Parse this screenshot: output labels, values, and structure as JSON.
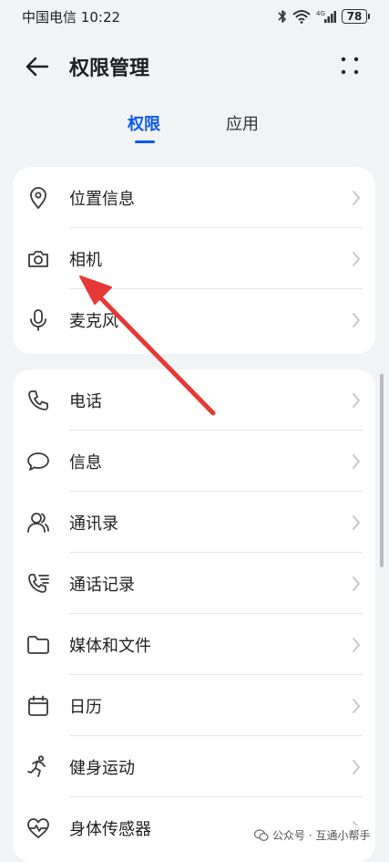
{
  "status_bar": {
    "carrier": "中国电信",
    "time": "10:22",
    "battery": "78"
  },
  "header": {
    "title": "权限管理"
  },
  "tabs": [
    {
      "label": "权限",
      "active": true
    },
    {
      "label": "应用",
      "active": false
    }
  ],
  "groups": [
    {
      "items": [
        {
          "label": "位置信息",
          "icon": "location-pin-icon"
        },
        {
          "label": "相机",
          "icon": "camera-icon"
        },
        {
          "label": "麦克风",
          "icon": "microphone-icon"
        }
      ]
    },
    {
      "items": [
        {
          "label": "电话",
          "icon": "phone-icon"
        },
        {
          "label": "信息",
          "icon": "message-bubble-icon"
        },
        {
          "label": "通讯录",
          "icon": "contacts-icon"
        },
        {
          "label": "通话记录",
          "icon": "call-log-icon"
        },
        {
          "label": "媒体和文件",
          "icon": "folder-icon"
        },
        {
          "label": "日历",
          "icon": "calendar-icon"
        },
        {
          "label": "健身运动",
          "icon": "running-icon"
        },
        {
          "label": "身体传感器",
          "icon": "heart-rate-icon"
        }
      ]
    }
  ],
  "watermark": {
    "text": "公众号 · 互通小帮手"
  },
  "colors": {
    "accent": "#0a59f7",
    "background": "#f1f3f5",
    "annotation_arrow": "#e53935"
  }
}
